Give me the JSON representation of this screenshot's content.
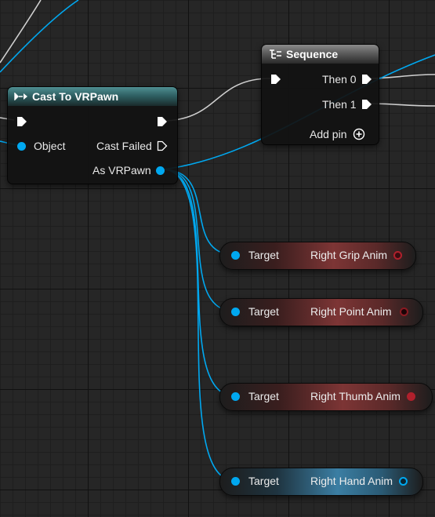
{
  "cast_node": {
    "title": "Cast To VRPawn",
    "object_pin": "Object",
    "cast_failed_pin": "Cast Failed",
    "as_pin": "As VRPawn",
    "header_color": "#2f6164"
  },
  "sequence_node": {
    "title": "Sequence",
    "then0": "Then 0",
    "then1": "Then 1",
    "add_pin": "Add pin",
    "header_color": "#5c5c5c"
  },
  "var_nodes": [
    {
      "target": "Target",
      "name": "Right Grip Anim",
      "color": "#7d3535"
    },
    {
      "target": "Target",
      "name": "Right Point Anim",
      "color": "#7d3535"
    },
    {
      "target": "Target",
      "name": "Right Thumb Anim",
      "color": "#7d3535"
    },
    {
      "target": "Target",
      "name": "Right Hand Anim",
      "color": "#3b7ea3"
    }
  ],
  "colors": {
    "object_wire": "#00a8f0",
    "exec_wire": "#cfcfcf",
    "anim_pin": "#b0202c",
    "hand_pin": "#00a8f0"
  }
}
